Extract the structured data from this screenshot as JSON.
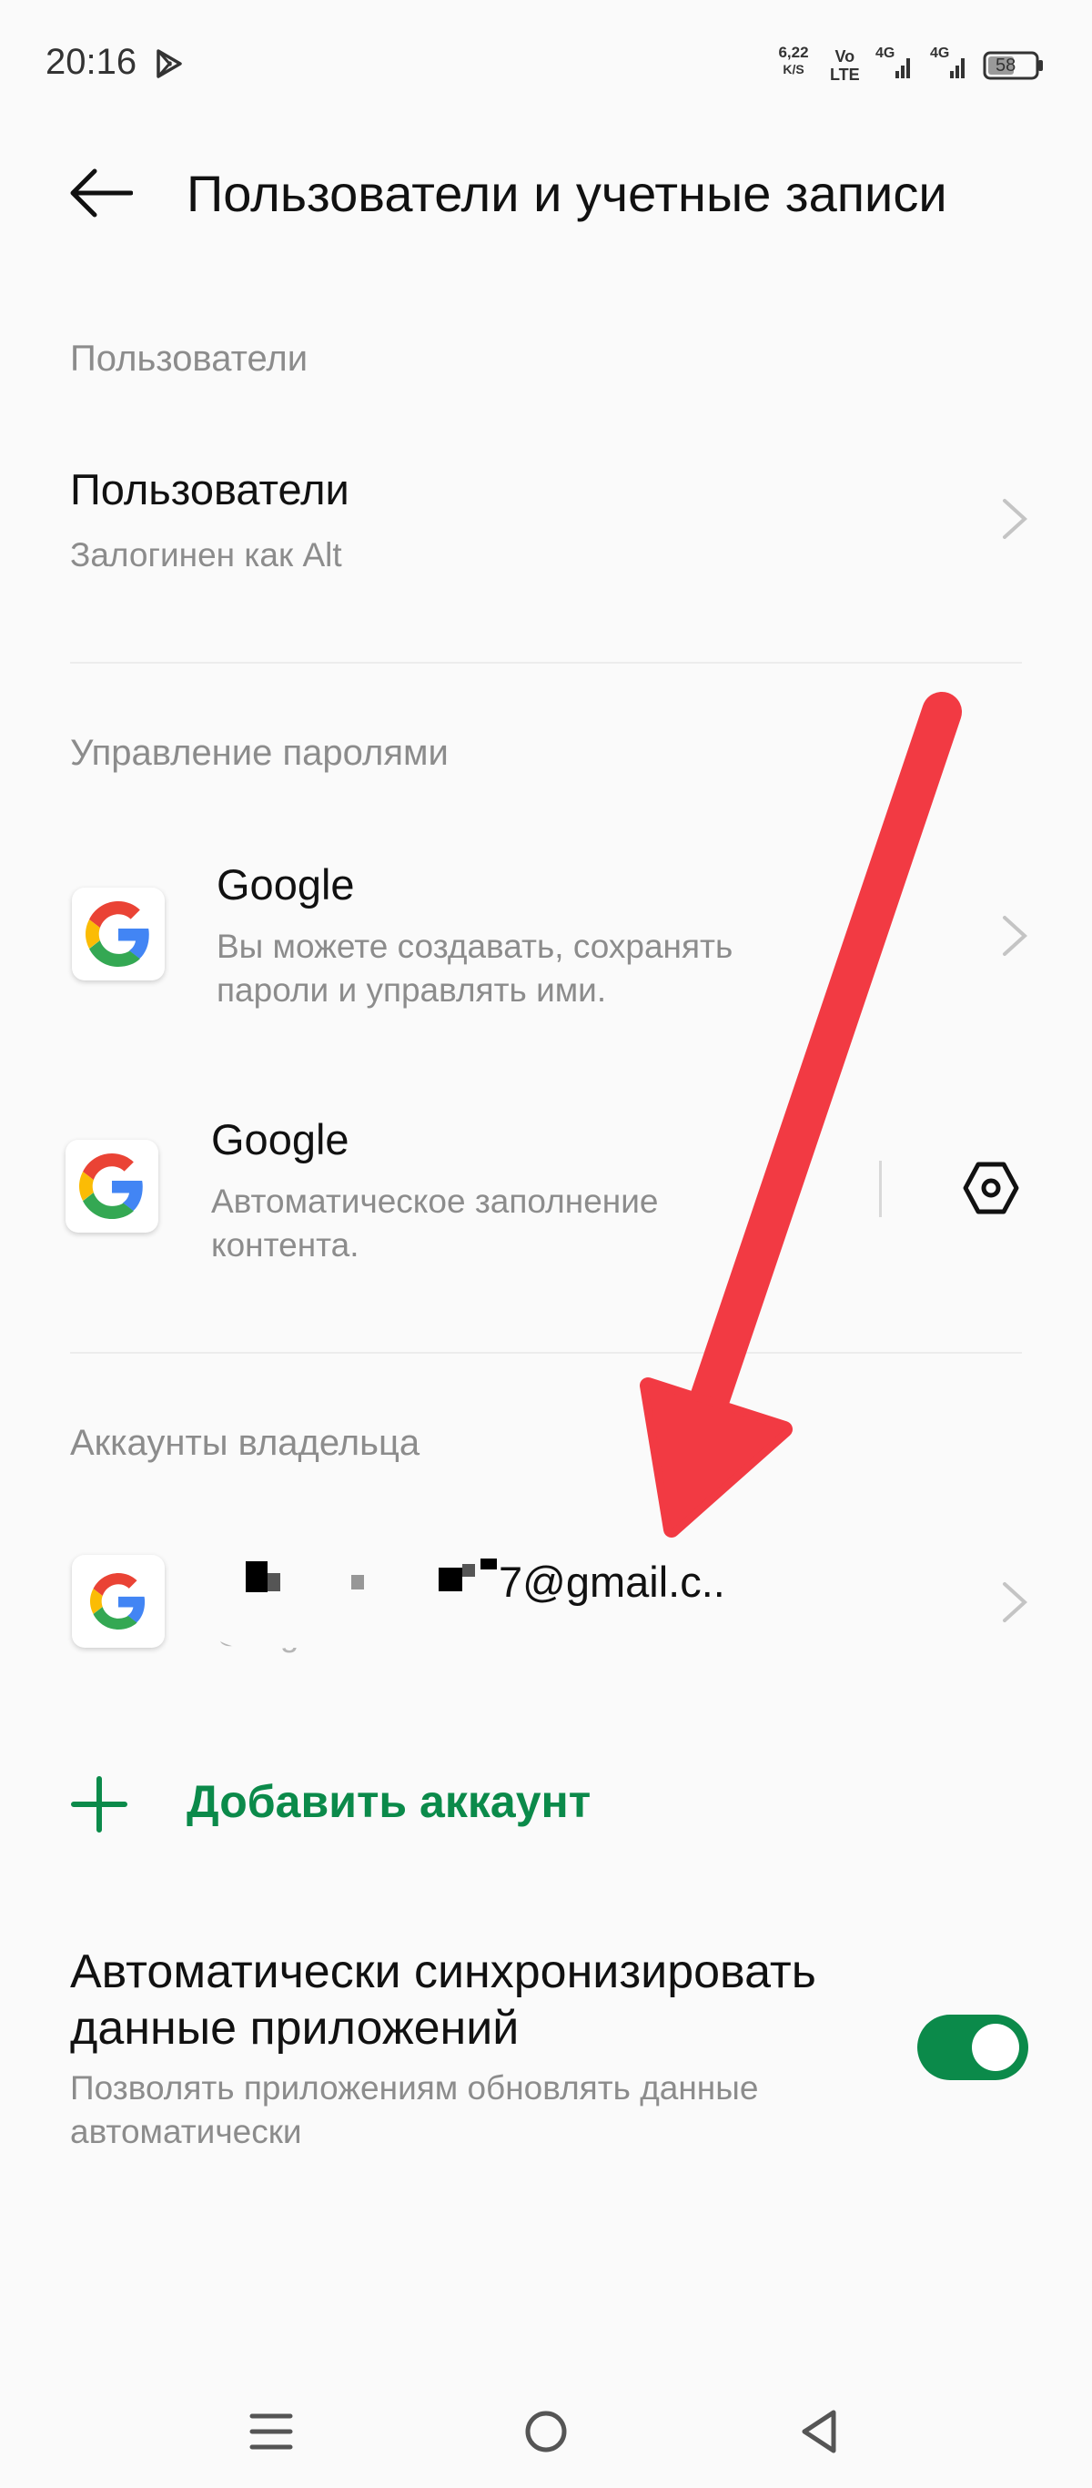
{
  "status_bar": {
    "time": "20:16",
    "speed_value": "6,22",
    "speed_unit": "K/S",
    "volte_top": "Vo",
    "volte_bottom": "LTE",
    "net1": "4G",
    "net2": "4G",
    "battery": "58"
  },
  "header": {
    "title": "Пользователи и учетные записи"
  },
  "users_section": {
    "header": "Пользователи",
    "item_title": "Пользователи",
    "item_sub": "Залогинен как Alt"
  },
  "passwords_section": {
    "header": "Управление паролями",
    "google1_title": "Google",
    "google1_sub": "Вы можете создавать, сохранять пароли и управлять ими.",
    "google2_title": "Google",
    "google2_sub": "Автоматическое заполнение контента."
  },
  "owner_section": {
    "header": "Аккаунты владельца",
    "account_email": "7@gmail.c..",
    "account_sub": "Google"
  },
  "add_account": {
    "label": "Добавить аккаунт"
  },
  "sync": {
    "title": "Автоматически синхронизировать данные приложений",
    "sub": "Позволять приложениям обновлять данные автоматически",
    "enabled": true
  },
  "colors": {
    "accent_green": "#0b8a4a",
    "arrow_red": "#f23a43"
  }
}
